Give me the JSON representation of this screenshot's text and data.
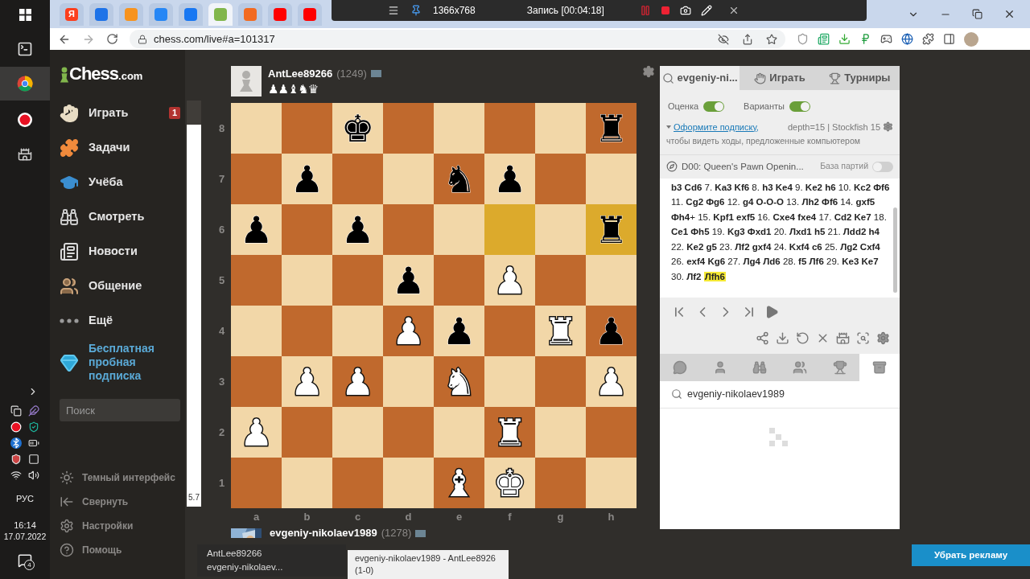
{
  "browser": {
    "tabs": [
      {
        "text": "Я",
        "color": "#fc3f1d",
        "selected": false
      },
      {
        "color": "#1e73e8",
        "selected": false
      },
      {
        "color": "#f7931e",
        "selected": false
      },
      {
        "color": "#2787f5",
        "selected": false
      },
      {
        "color": "#1877f2",
        "selected": false
      },
      {
        "color": "#81b64c",
        "selected": true
      },
      {
        "color": "#f26a21",
        "selected": false
      },
      {
        "color": "#ff0000",
        "selected": false
      },
      {
        "color": "#ff0000",
        "selected": false
      }
    ],
    "recorder": {
      "resolution": "1366x768",
      "status": "Запись [00:04:18]"
    },
    "url": "chess.com/live#a=101317"
  },
  "taskbar": {
    "language": "РУС",
    "time": "16:14",
    "date": "17.07.2022",
    "notifications": "4"
  },
  "sidebar": {
    "logo": {
      "name": "Chess",
      "suffix": ".com"
    },
    "items": [
      {
        "kind": "play",
        "label": "Играть",
        "badge": "1"
      },
      {
        "kind": "puzzles",
        "label": "Задачи"
      },
      {
        "kind": "learn",
        "label": "Учёба"
      },
      {
        "kind": "watch",
        "label": "Смотреть"
      },
      {
        "kind": "news",
        "label": "Новости"
      },
      {
        "kind": "social",
        "label": "Общение"
      },
      {
        "kind": "more",
        "label": "Ещё"
      }
    ],
    "promo": "Бесплатная пробная подписка",
    "search": {
      "placeholder": "Поиск"
    },
    "footer": [
      {
        "kind": "theme",
        "label": "Темный интерфейс"
      },
      {
        "kind": "collapse",
        "label": "Свернуть"
      },
      {
        "kind": "settings",
        "label": "Настройки"
      },
      {
        "kind": "help",
        "label": "Помощь"
      }
    ]
  },
  "eval": {
    "reading": "5.7",
    "level": 0.94
  },
  "board": {
    "top_player": {
      "name": "AntLee89266",
      "rating": "(1249)",
      "captured": "♟♟♝♞♛"
    },
    "ranks": [
      {
        "label": "8",
        "squares": [
          {
            "highlighted": false
          },
          {
            "highlighted": false
          },
          {
            "piece": "♚",
            "white": false,
            "highlighted": false
          },
          {
            "highlighted": false
          },
          {
            "highlighted": false
          },
          {
            "highlighted": false
          },
          {
            "highlighted": false
          },
          {
            "piece": "♜",
            "white": false,
            "highlighted": false
          }
        ]
      },
      {
        "label": "7",
        "squares": [
          {
            "highlighted": false
          },
          {
            "piece": "♟",
            "white": false,
            "highlighted": false
          },
          {
            "highlighted": false
          },
          {
            "highlighted": false
          },
          {
            "piece": "♞",
            "white": false,
            "highlighted": false
          },
          {
            "piece": "♟",
            "white": false,
            "highlighted": false
          },
          {
            "highlighted": false
          },
          {
            "highlighted": false
          }
        ]
      },
      {
        "label": "6",
        "squares": [
          {
            "piece": "♟",
            "white": false,
            "highlighted": false
          },
          {
            "highlighted": false
          },
          {
            "piece": "♟",
            "white": false,
            "highlighted": false
          },
          {
            "highlighted": false
          },
          {
            "highlighted": false
          },
          {
            "highlighted": true
          },
          {
            "highlighted": false
          },
          {
            "piece": "♜",
            "white": false,
            "highlighted": true
          }
        ]
      },
      {
        "label": "5",
        "squares": [
          {
            "highlighted": false
          },
          {
            "highlighted": false
          },
          {
            "highlighted": false
          },
          {
            "piece": "♟",
            "white": false,
            "highlighted": false
          },
          {
            "highlighted": false
          },
          {
            "piece": "♟",
            "white": true,
            "highlighted": false
          },
          {
            "highlighted": false
          },
          {
            "highlighted": false
          }
        ]
      },
      {
        "label": "4",
        "squares": [
          {
            "highlighted": false
          },
          {
            "highlighted": false
          },
          {
            "highlighted": false
          },
          {
            "piece": "♟",
            "white": true,
            "highlighted": false
          },
          {
            "piece": "♟",
            "white": false,
            "highlighted": false
          },
          {
            "highlighted": false
          },
          {
            "piece": "♜",
            "white": true,
            "highlighted": false
          },
          {
            "piece": "♟",
            "white": false,
            "highlighted": false
          }
        ]
      },
      {
        "label": "3",
        "squares": [
          {
            "highlighted": false
          },
          {
            "piece": "♟",
            "white": true,
            "highlighted": false
          },
          {
            "piece": "♟",
            "white": true,
            "highlighted": false
          },
          {
            "highlighted": false
          },
          {
            "piece": "♞",
            "white": true,
            "highlighted": false
          },
          {
            "highlighted": false
          },
          {
            "highlighted": false
          },
          {
            "piece": "♟",
            "white": true,
            "highlighted": false
          }
        ]
      },
      {
        "label": "2",
        "squares": [
          {
            "piece": "♟",
            "white": true,
            "highlighted": false
          },
          {
            "highlighted": false
          },
          {
            "highlighted": false
          },
          {
            "highlighted": false
          },
          {
            "highlighted": false
          },
          {
            "piece": "♜",
            "white": true,
            "highlighted": false
          },
          {
            "highlighted": false
          },
          {
            "highlighted": false
          }
        ]
      },
      {
        "label": "1",
        "squares": [
          {
            "highlighted": false
          },
          {
            "highlighted": false
          },
          {
            "highlighted": false
          },
          {
            "highlighted": false
          },
          {
            "piece": "♝",
            "white": true,
            "highlighted": false
          },
          {
            "piece": "♚",
            "white": true,
            "highlighted": false
          },
          {
            "highlighted": false
          },
          {
            "highlighted": false
          }
        ]
      }
    ],
    "files": [
      "a",
      "b",
      "c",
      "d",
      "e",
      "f",
      "g",
      "h"
    ],
    "bottom_player": {
      "name": "evgeniy-nikolaev1989",
      "rating": "(1278)"
    }
  },
  "popups": {
    "preview": [
      "AntLee89266",
      "evgeniy-nikolaev..."
    ],
    "tooltip": {
      "title": "evgeniy-nikolaev1989 - AntLee8926",
      "result": "(1-0)"
    }
  },
  "panel": {
    "tabs": [
      {
        "kind": "analysis",
        "label": "evgeniy-ni...",
        "selected": true
      },
      {
        "kind": "play",
        "label": "Играть",
        "selected": false
      },
      {
        "kind": "tournaments",
        "label": "Турниры",
        "selected": false
      }
    ],
    "toggles": [
      {
        "label": "Оценка",
        "on": true
      },
      {
        "label": "Варианты",
        "on": true
      }
    ],
    "subscribe": {
      "link": "Оформите подписку,",
      "engine": "depth=15 | Stockfish 15",
      "note": "чтобы видеть ходы, предложенные компьютером"
    },
    "opening": {
      "name": "D00: Queen's Pawn Openin...",
      "database": {
        "label": "База партий",
        "on": false
      }
    },
    "moves": {
      "text": "**b3 Cd6** 7. **Ka3 Kf6** 8. **h3 Ke4** 9. **Ke2 h6** 10. **Kc2 Фf6** 11. **Cg2 Фg6** 12. **g4 O-O-O** 13. **Лh2 Фf6** 14. **gxf5 Фh4**+ 15. **Kpf1 exf5** 16. **Cxe4 fxe4** 17. **Cd2 Ke7** 18. **Ce1 Фh5** 19. **Kg3 Фxd1** 20. **Лxd1 h5** 21. **Лdd2 h4** 22. **Ke2 g5** 23. **Лf2 gxf4** 24. **Kxf4 c6** 25. **Лg2 Cxf4** 26. **exf4 Kg6** 27. **Лg4 Лd6** 28. **f5 Лf6** 29. **Ke3 Ke7** 30. **Лf2**",
      "current": "Лfh6"
    },
    "bottom_tabs": [
      {
        "kind": "chat",
        "selected": false
      },
      {
        "kind": "player",
        "selected": false
      },
      {
        "kind": "watch",
        "selected": false
      },
      {
        "kind": "friends",
        "selected": false
      },
      {
        "kind": "standings",
        "selected": false
      },
      {
        "kind": "archive",
        "selected": true
      }
    ],
    "search": {
      "value": "evgeniy-nikolaev1989"
    }
  },
  "ad_button": "Убрать рекламу"
}
